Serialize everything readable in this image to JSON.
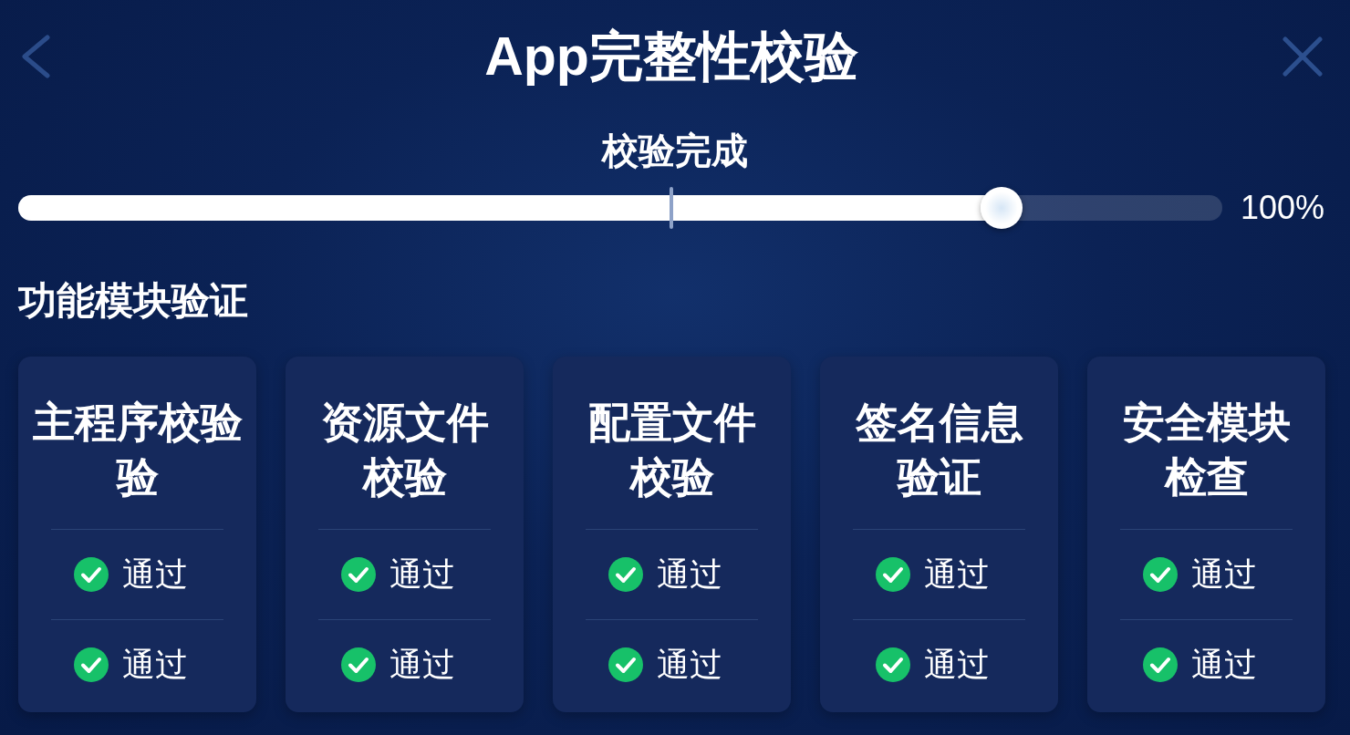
{
  "header": {
    "title": "App完整性校验"
  },
  "progress": {
    "label": "校验完成",
    "level": 0.817,
    "reading": "100%"
  },
  "section": {
    "title": "功能模块验证"
  },
  "modules": [
    {
      "title_lines": [
        "主程序校验",
        "验"
      ],
      "checks": [
        {
          "passed": true,
          "label": "通过"
        },
        {
          "passed": true,
          "label": "通过"
        }
      ]
    },
    {
      "title_lines": [
        "资源文件",
        "校验"
      ],
      "checks": [
        {
          "passed": true,
          "label": "通过"
        },
        {
          "passed": true,
          "label": "通过"
        }
      ]
    },
    {
      "title_lines": [
        "配置文件",
        "校验"
      ],
      "checks": [
        {
          "passed": true,
          "label": "通过"
        },
        {
          "passed": true,
          "label": "通过"
        }
      ]
    },
    {
      "title_lines": [
        "签名信息",
        "验证"
      ],
      "checks": [
        {
          "passed": true,
          "label": "通过"
        },
        {
          "passed": true,
          "label": "通过"
        }
      ]
    },
    {
      "title_lines": [
        "安全模块",
        "检查"
      ],
      "checks": [
        {
          "passed": true,
          "label": "通过"
        },
        {
          "passed": true,
          "label": "通过"
        }
      ]
    }
  ]
}
